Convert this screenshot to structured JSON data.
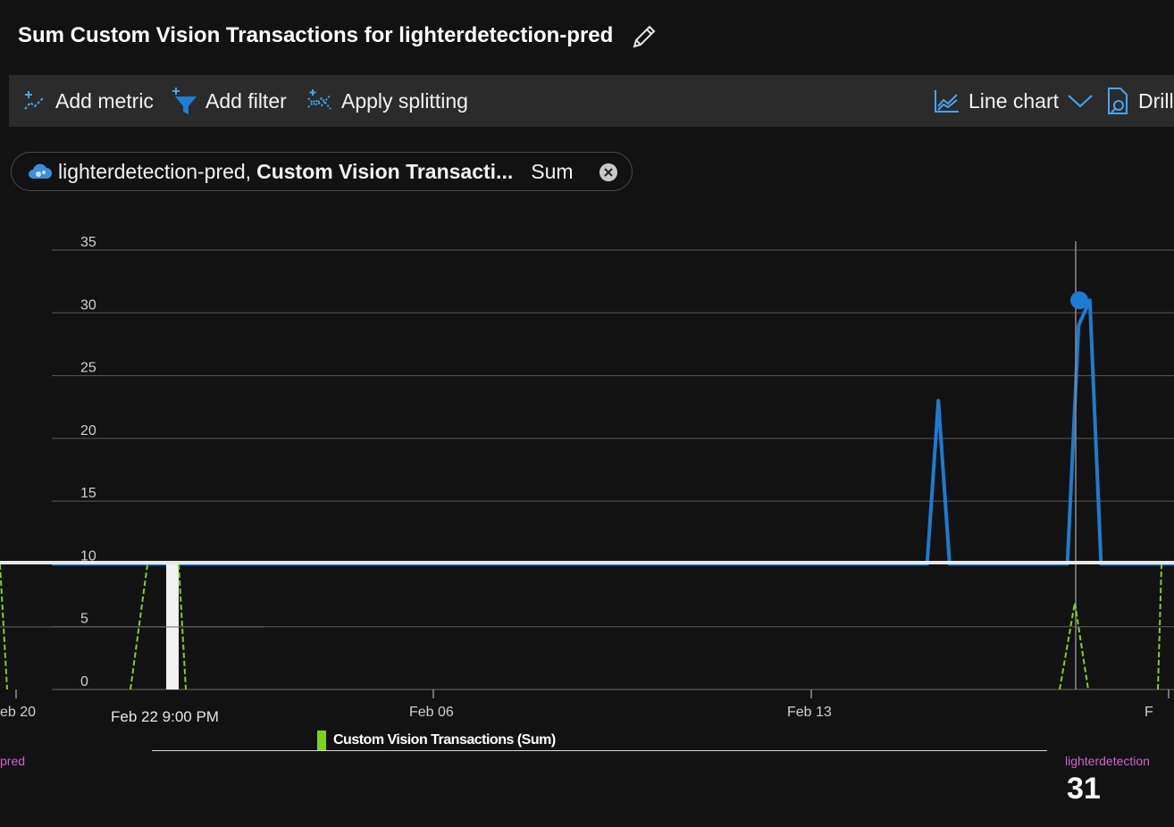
{
  "title": "Sum Custom Vision Transactions for lighterdetection-pred",
  "toolbar": {
    "add_metric": "Add metric",
    "add_filter": "Add filter",
    "apply_splitting": "Apply splitting",
    "line_chart": "Line chart",
    "drill": "Drill"
  },
  "metric_pill": {
    "resource": "lighterdetection-pred,",
    "metric": "Custom Vision Transacti...",
    "aggregation": "Sum"
  },
  "legend": {
    "series_label": "Custom Vision Transactions (Sum)",
    "resource_short": "pred",
    "resource_right": "lighterdetection",
    "value": "31"
  },
  "tooltip_time": "Feb 22 9:00 PM",
  "chart_data": {
    "type": "line",
    "ylim": [
      0,
      35
    ],
    "y_ticks": [
      "35",
      "30",
      "25",
      "20",
      "15",
      "10",
      "5",
      "0"
    ],
    "x_ticks": [
      "eb 20",
      "Feb 06",
      "Feb 13",
      "F"
    ],
    "series": [
      {
        "name": "Custom Vision Transactions (Sum)",
        "color": "#1c7bd2",
        "points": [
          {
            "x": 0.0,
            "y": 10
          },
          {
            "x": 0.78,
            "y": 10
          },
          {
            "x": 0.79,
            "y": 23
          },
          {
            "x": 0.8,
            "y": 10
          },
          {
            "x": 0.905,
            "y": 10
          },
          {
            "x": 0.915,
            "y": 29
          },
          {
            "x": 0.925,
            "y": 31
          },
          {
            "x": 0.935,
            "y": 10
          },
          {
            "x": 1.0,
            "y": 10
          }
        ]
      }
    ],
    "highlight": {
      "y": 31
    },
    "accent_color": "#7fd11a"
  }
}
